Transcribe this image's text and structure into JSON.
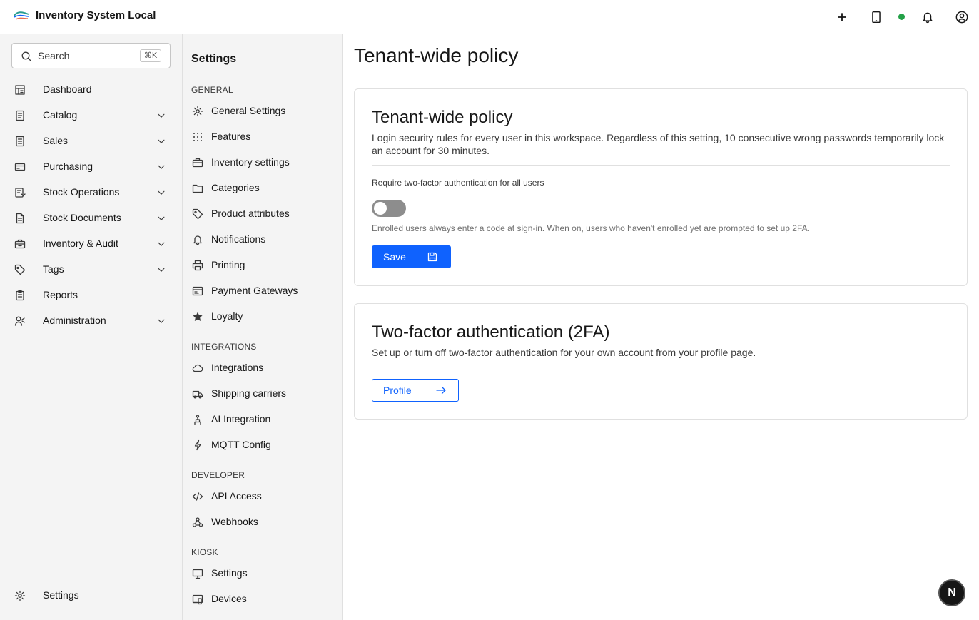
{
  "header": {
    "app_title": "Inventory System Local",
    "logo_icon": "app-logo-icon",
    "actions": [
      "plus-icon",
      "tablet-icon",
      "status-online",
      "bell-icon",
      "user-avatar-icon"
    ],
    "status_color": "#24a148"
  },
  "sidebar": {
    "search_placeholder": "Search",
    "search_shortcut": "⌘K",
    "items": [
      {
        "label": "Dashboard",
        "icon": "dashboard-icon",
        "expandable": false
      },
      {
        "label": "Catalog",
        "icon": "catalog-icon",
        "expandable": true
      },
      {
        "label": "Sales",
        "icon": "sales-icon",
        "expandable": true
      },
      {
        "label": "Purchasing",
        "icon": "purchasing-icon",
        "expandable": true
      },
      {
        "label": "Stock Operations",
        "icon": "stock-operations-icon",
        "expandable": true
      },
      {
        "label": "Stock Documents",
        "icon": "document-icon",
        "expandable": true
      },
      {
        "label": "Inventory & Audit",
        "icon": "inventory-audit-icon",
        "expandable": true
      },
      {
        "label": "Tags",
        "icon": "tag-icon",
        "expandable": true
      },
      {
        "label": "Reports",
        "icon": "reports-icon",
        "expandable": false
      },
      {
        "label": "Administration",
        "icon": "admin-icon",
        "expandable": true
      }
    ],
    "footer_label": "Settings"
  },
  "settings_nav": {
    "title": "Settings",
    "sections": [
      {
        "heading": "GENERAL",
        "items": [
          "General Settings",
          "Features",
          "Inventory settings",
          "Categories",
          "Product attributes",
          "Notifications",
          "Printing",
          "Payment Gateways",
          "Loyalty"
        ]
      },
      {
        "heading": "INTEGRATIONS",
        "items": [
          "Integrations",
          "Shipping carriers",
          "AI Integration",
          "MQTT Config"
        ]
      },
      {
        "heading": "DEVELOPER",
        "items": [
          "API Access",
          "Webhooks"
        ]
      },
      {
        "heading": "KIOSK",
        "items": [
          "Settings",
          "Devices"
        ]
      }
    ]
  },
  "main": {
    "page_title": "Tenant-wide policy",
    "policy_card": {
      "title": "Tenant-wide policy",
      "description": "Login security rules for every user in this workspace. Regardless of this setting, 10 consecutive wrong passwords temporarily lock an account for 30 minutes.",
      "toggle_label": "Require two-factor authentication for all users",
      "toggle_on": false,
      "helper": "Enrolled users always enter a code at sign-in. When on, users who haven't enrolled yet are prompted to set up 2FA.",
      "save_label": "Save"
    },
    "twofa_card": {
      "title": "Two-factor authentication (2FA)",
      "description": "Set up or turn off two-factor authentication for your own account from your profile page.",
      "profile_label": "Profile"
    }
  },
  "fab_label": "N",
  "colors": {
    "primary": "#0f62fe",
    "toggle_off": "#8d8d8d"
  }
}
